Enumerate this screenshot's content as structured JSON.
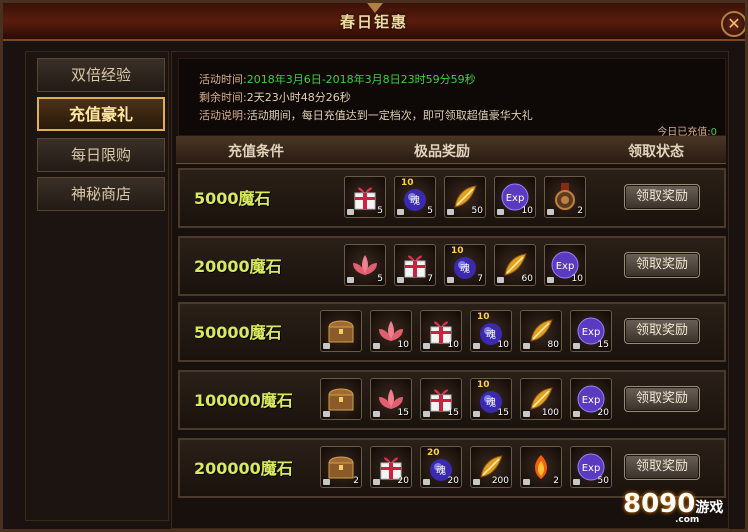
{
  "window": {
    "title": "春日钜惠",
    "close_glyph": "✕"
  },
  "sidebar": {
    "tabs": [
      {
        "label": "双倍经验",
        "active": false
      },
      {
        "label": "充值豪礼",
        "active": true
      },
      {
        "label": "每日限购",
        "active": false
      },
      {
        "label": "神秘商店",
        "active": false
      }
    ]
  },
  "info": {
    "time_label": "活动时间:",
    "time_value": "2018年3月6日-2018年3月8日23时59分59秒",
    "remain_label": "剩余时间:",
    "remain_value": "2天23小时48分26秒",
    "desc_label": "活动说明:",
    "desc_value": "活动期间，每日充值达到一定档次，即可领取超值豪华大礼",
    "today_label": "今日已充值:",
    "today_value": "0"
  },
  "table": {
    "headers": {
      "condition": "充值条件",
      "reward": "极品奖励",
      "status": "领取状态"
    },
    "claim_label": "领取奖励",
    "rows": [
      {
        "condition": "5000魔石",
        "items": [
          {
            "icon": "gift-box",
            "count": "5"
          },
          {
            "icon": "soul-orb",
            "count": "5",
            "level": "10"
          },
          {
            "icon": "golden-feather",
            "count": "50"
          },
          {
            "icon": "exp-orb",
            "count": "10"
          },
          {
            "icon": "medal",
            "count": "2"
          }
        ]
      },
      {
        "condition": "20000魔石",
        "items": [
          {
            "icon": "lotus",
            "count": "5"
          },
          {
            "icon": "gift-box",
            "count": "7"
          },
          {
            "icon": "soul-orb",
            "count": "7",
            "level": "10"
          },
          {
            "icon": "golden-feather",
            "count": "60"
          },
          {
            "icon": "exp-orb",
            "count": "10"
          }
        ]
      },
      {
        "condition": "50000魔石",
        "items": [
          {
            "icon": "treasure-chest",
            "count": ""
          },
          {
            "icon": "lotus",
            "count": "10"
          },
          {
            "icon": "gift-box",
            "count": "10"
          },
          {
            "icon": "soul-orb",
            "count": "10",
            "level": "10"
          },
          {
            "icon": "golden-feather",
            "count": "80"
          },
          {
            "icon": "exp-orb",
            "count": "15"
          }
        ]
      },
      {
        "condition": "100000魔石",
        "items": [
          {
            "icon": "treasure-chest",
            "count": ""
          },
          {
            "icon": "lotus",
            "count": "15"
          },
          {
            "icon": "gift-box",
            "count": "15"
          },
          {
            "icon": "soul-orb",
            "count": "15",
            "level": "10"
          },
          {
            "icon": "golden-feather",
            "count": "100"
          },
          {
            "icon": "exp-orb",
            "count": "20"
          }
        ]
      },
      {
        "condition": "200000魔石",
        "items": [
          {
            "icon": "treasure-chest",
            "count": "2"
          },
          {
            "icon": "gift-box",
            "count": "20"
          },
          {
            "icon": "soul-orb",
            "count": "20",
            "level": "20"
          },
          {
            "icon": "golden-feather",
            "count": "200"
          },
          {
            "icon": "fire-feather",
            "count": "2"
          },
          {
            "icon": "exp-orb",
            "count": "50"
          }
        ]
      }
    ]
  },
  "watermark": {
    "num": "8090",
    "suffix": "游戏",
    "domain": ".com"
  },
  "colors": {
    "highlight": "#40d040",
    "gold": "#e0b050",
    "condition": "#d8e860"
  }
}
